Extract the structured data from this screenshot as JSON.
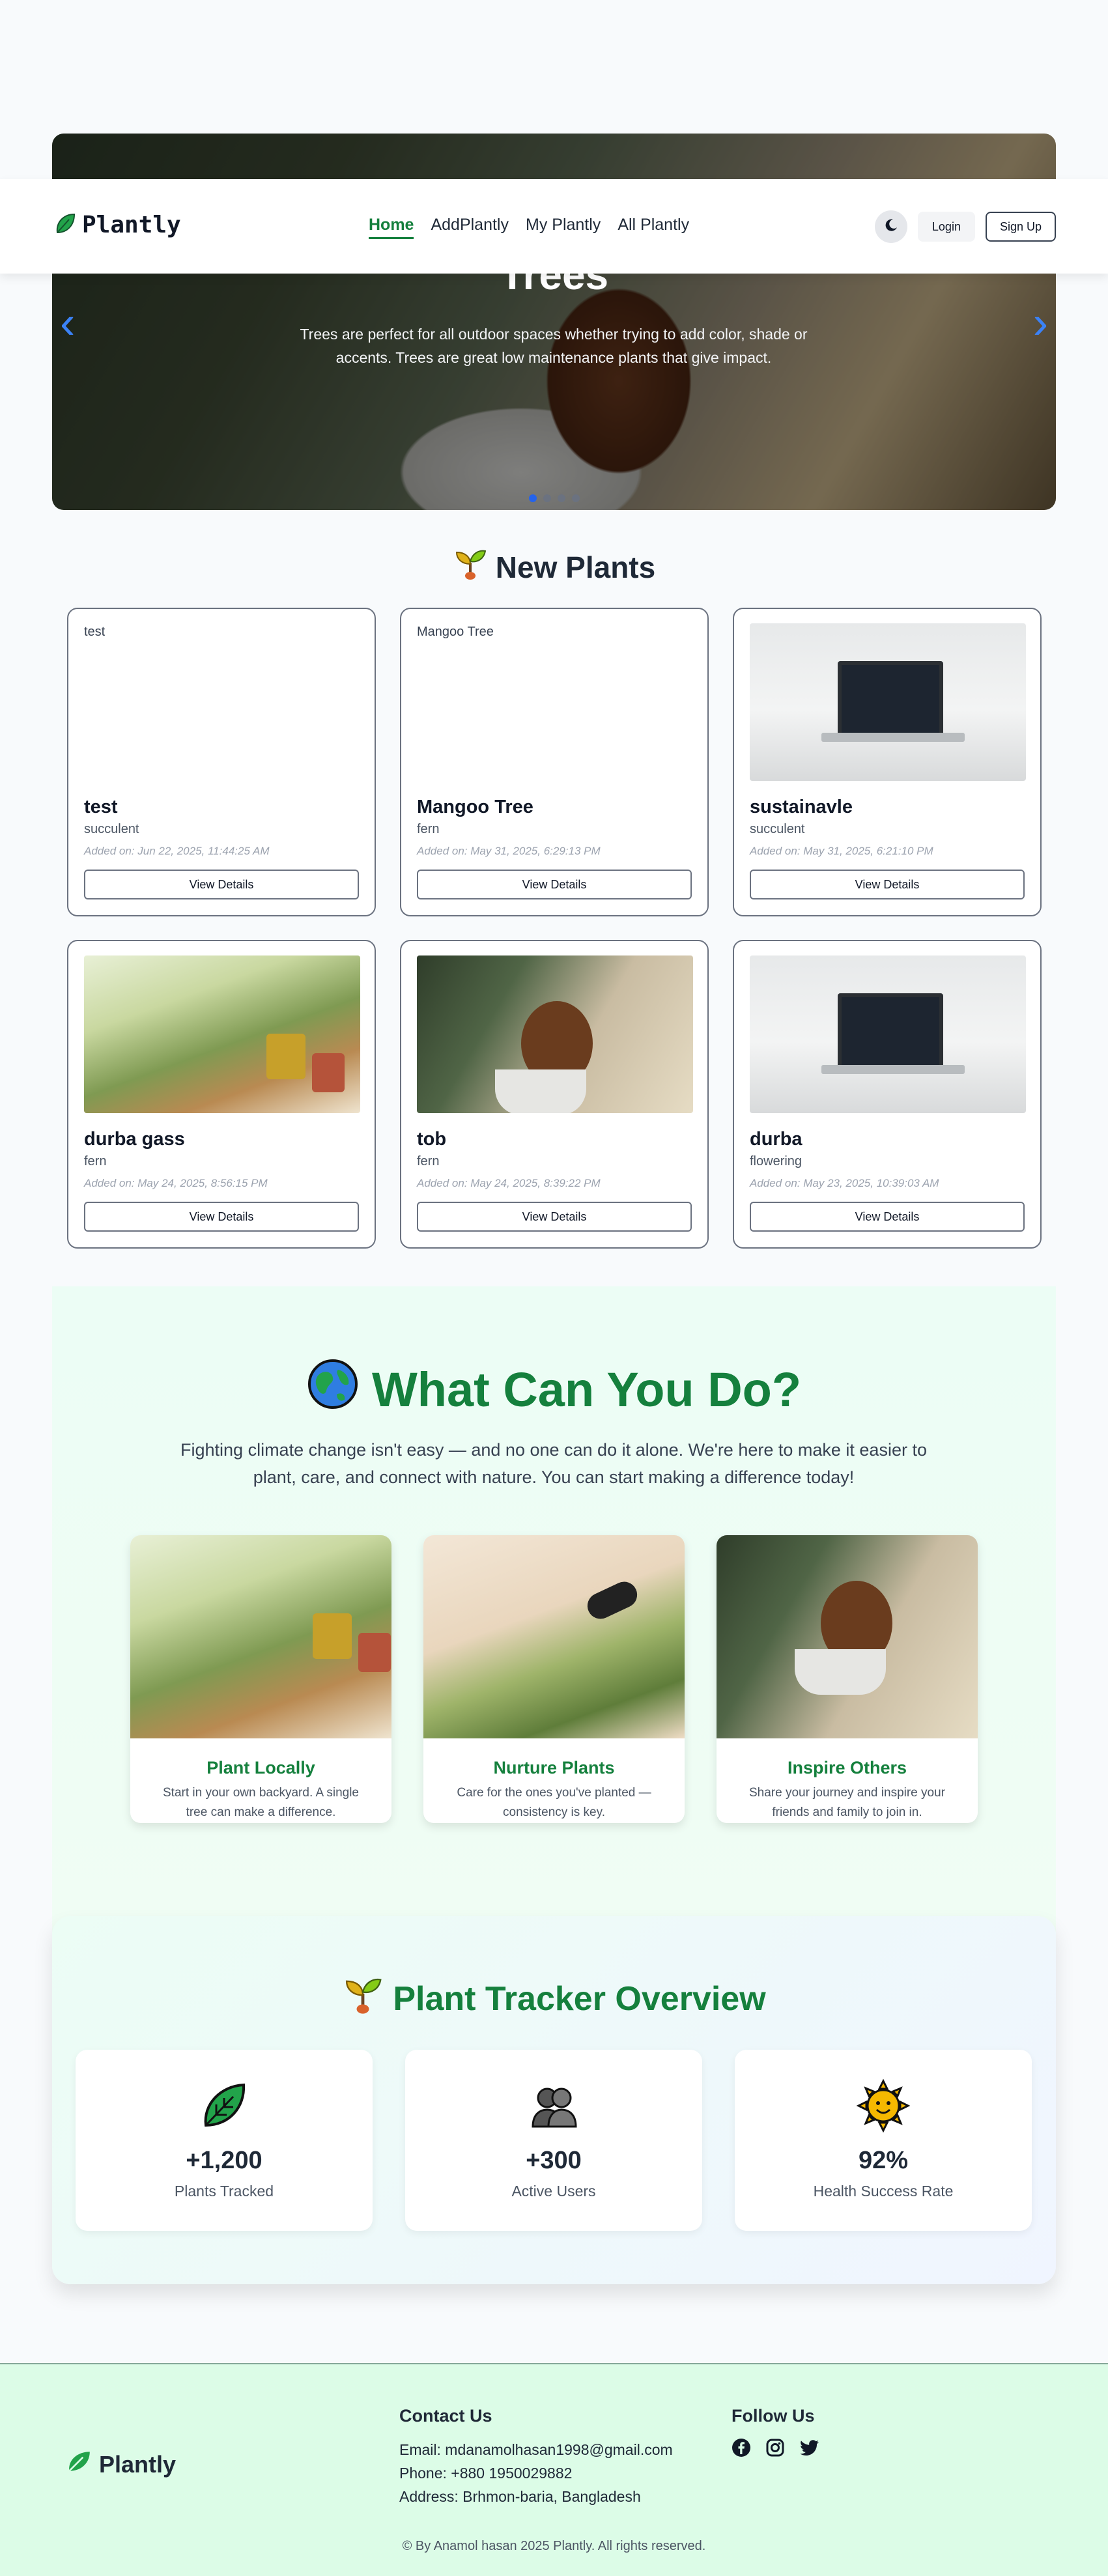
{
  "hero": {
    "title": "Trees",
    "description": "Trees are perfect for all outdoor spaces whether trying to add color, shade or accents. Trees are great low maintenance plants that give impact.",
    "slides_total": 4,
    "active_slide": 1
  },
  "navbar": {
    "brand": "Plantly",
    "links": [
      "Home",
      "AddPlantly",
      "My Plantly",
      "All Plantly"
    ],
    "active_link": "Home",
    "login_label": "Login",
    "signup_label": "Sign Up"
  },
  "new_plants": {
    "title": "New Plants",
    "button_label": "View Details",
    "cards": [
      {
        "name": "test",
        "type": "succulent",
        "date": "Added on: Jun 22, 2025, 11:44:25 AM",
        "image_alt": "test",
        "image": "broken"
      },
      {
        "name": "Mangoo Tree",
        "type": "fern",
        "date": "Added on: May 31, 2025, 6:29:13 PM",
        "image_alt": "Mangoo Tree",
        "image": "broken"
      },
      {
        "name": "sustainavle",
        "type": "succulent",
        "date": "Added on: May 31, 2025, 6:21:10 PM",
        "image_alt": "",
        "image": "laptop"
      },
      {
        "name": "durba gass",
        "type": "fern",
        "date": "Added on: May 24, 2025, 8:56:15 PM",
        "image_alt": "",
        "image": "garden"
      },
      {
        "name": "tob",
        "type": "fern",
        "date": "Added on: May 24, 2025, 8:39:22 PM",
        "image_alt": "",
        "image": "roots"
      },
      {
        "name": "durba",
        "type": "flowering",
        "date": "Added on: May 23, 2025, 10:39:03 AM",
        "image_alt": "",
        "image": "laptop"
      }
    ]
  },
  "what_can_you_do": {
    "title": "What Can You Do?",
    "description": "Fighting climate change isn't easy — and no one can do it alone. We're here to make it easier to plant, care, and connect with nature. You can start making a difference today!",
    "cards": [
      {
        "title": "Plant Locally",
        "description": "Start in your own backyard. A single tree can make a difference.",
        "image": "garden"
      },
      {
        "title": "Nurture Plants",
        "description": "Care for the ones you've planted — consistency is key.",
        "image": "pruning"
      },
      {
        "title": "Inspire Others",
        "description": "Share your journey and inspire your friends and family to join in.",
        "image": "roots"
      }
    ]
  },
  "tracker": {
    "title": "Plant Tracker Overview",
    "stats": [
      {
        "value": "+1,200",
        "label": "Plants Tracked",
        "icon": "leaf-icon"
      },
      {
        "value": "+300",
        "label": "Active Users",
        "icon": "users-icon"
      },
      {
        "value": "92%",
        "label": "Health Success Rate",
        "icon": "sun-icon"
      }
    ]
  },
  "footer": {
    "brand": "Plantly",
    "contact_heading": "Contact Us",
    "email": "Email: mdanamolhasan1998@gmail.com",
    "phone": "Phone: +880 1950029882",
    "address": "Address: Brhmon-baria, Bangladesh",
    "follow_heading": "Follow Us",
    "socials": [
      "facebook-icon",
      "instagram-icon",
      "twitter-icon"
    ],
    "copyright": "© By Anamol hasan 2025 Plantly. All rights reserved."
  },
  "colors": {
    "brand_green": "#15803d",
    "accent_blue": "#2563eb",
    "footer_bg": "#dcfce7"
  }
}
